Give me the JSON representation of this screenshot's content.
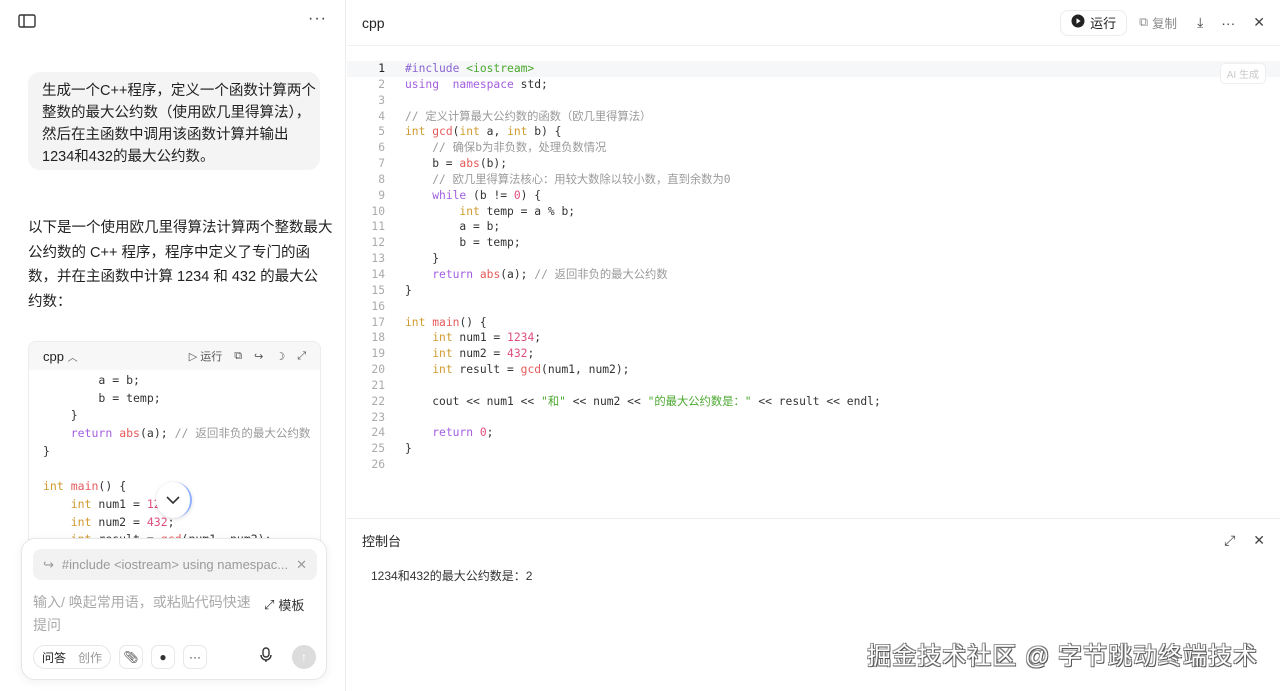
{
  "left": {
    "user_message_lines": [
      "生成一个C++程序，定义一个函数计算两个",
      "整数的最大公约数（使用欧几里得算法），",
      "然后在主函数中调用该函数计算并输出",
      "1234和432的最大公约数。"
    ],
    "answer_lines": [
      "以下是一个使用欧几里得算法计算两个整数最大",
      "公约数的 C++ 程序，程序中定义了专门的函",
      "数，并在主函数中计算 1234 和 432 的最大公",
      "约数："
    ],
    "code_card": {
      "lang": "cpp",
      "run_label": "运行"
    },
    "composer": {
      "quote_text": "#include <iostream> using namespac...",
      "placeholder": "输入/ 唤起常用语，或粘贴代码快速提问",
      "template_label": "模板",
      "mode_qa": "问答",
      "mode_create": "创作"
    }
  },
  "right": {
    "title": "cpp",
    "run_label": "运行",
    "copy_label": "复制",
    "ai_tag": "AI 生成",
    "console_title": "控制台",
    "console_output": "1234和432的最大公约数是：2"
  },
  "watermark": "掘金技术社区 @ 字节跳动终端技术",
  "code_lines": [
    [
      [
        "pp",
        "#include "
      ],
      [
        "inc",
        "<iostream>"
      ]
    ],
    [
      [
        "kw",
        "using"
      ],
      [
        "",
        "  "
      ],
      [
        "kw",
        "namespace"
      ],
      [
        "",
        " std;"
      ]
    ],
    [],
    [
      [
        "cm",
        "// 定义计算最大公约数的函数（欧几里得算法）"
      ]
    ],
    [
      [
        "ty",
        "int"
      ],
      [
        "",
        " "
      ],
      [
        "fn",
        "gcd"
      ],
      [
        "",
        "("
      ],
      [
        "ty",
        "int"
      ],
      [
        "",
        " a, "
      ],
      [
        "ty",
        "int"
      ],
      [
        "",
        " b) {"
      ]
    ],
    [
      [
        "",
        "    "
      ],
      [
        "cm",
        "// 确保b为非负数，处理负数情况"
      ]
    ],
    [
      [
        "",
        "    b = "
      ],
      [
        "fn",
        "abs"
      ],
      [
        "",
        "(b);"
      ]
    ],
    [
      [
        "",
        "    "
      ],
      [
        "cm",
        "// 欧几里得算法核心：用较大数除以较小数，直到余数为0"
      ]
    ],
    [
      [
        "",
        "    "
      ],
      [
        "kw",
        "while"
      ],
      [
        "",
        " (b != "
      ],
      [
        "nm",
        "0"
      ],
      [
        "",
        ") {"
      ]
    ],
    [
      [
        "",
        "        "
      ],
      [
        "ty",
        "int"
      ],
      [
        "",
        " temp = a % b;"
      ]
    ],
    [
      [
        "",
        "        a = b;"
      ]
    ],
    [
      [
        "",
        "        b = temp;"
      ]
    ],
    [
      [
        "",
        "    }"
      ]
    ],
    [
      [
        "",
        "    "
      ],
      [
        "kw",
        "return"
      ],
      [
        "",
        " "
      ],
      [
        "fn",
        "abs"
      ],
      [
        "",
        "(a); "
      ],
      [
        "cm",
        "// 返回非负的最大公约数"
      ]
    ],
    [
      [
        "",
        "}"
      ]
    ],
    [],
    [
      [
        "ty",
        "int"
      ],
      [
        "",
        " "
      ],
      [
        "fn",
        "main"
      ],
      [
        "",
        "() {"
      ]
    ],
    [
      [
        "",
        "    "
      ],
      [
        "ty",
        "int"
      ],
      [
        "",
        " num1 = "
      ],
      [
        "nm",
        "1234"
      ],
      [
        "",
        ";"
      ]
    ],
    [
      [
        "",
        "    "
      ],
      [
        "ty",
        "int"
      ],
      [
        "",
        " num2 = "
      ],
      [
        "nm",
        "432"
      ],
      [
        "",
        ";"
      ]
    ],
    [
      [
        "",
        "    "
      ],
      [
        "ty",
        "int"
      ],
      [
        "",
        " result = "
      ],
      [
        "fn",
        "gcd"
      ],
      [
        "",
        "(num1, num2);"
      ]
    ],
    [],
    [
      [
        "",
        "    cout << num1 << "
      ],
      [
        "st",
        "\"和\""
      ],
      [
        "",
        " << num2 << "
      ],
      [
        "st",
        "\"的最大公约数是：\""
      ],
      [
        "",
        " << result << endl;"
      ]
    ],
    [],
    [
      [
        "",
        "    "
      ],
      [
        "kw",
        "return"
      ],
      [
        "",
        " "
      ],
      [
        "nm",
        "0"
      ],
      [
        "",
        ";"
      ]
    ],
    [
      [
        "",
        "}"
      ]
    ],
    []
  ]
}
